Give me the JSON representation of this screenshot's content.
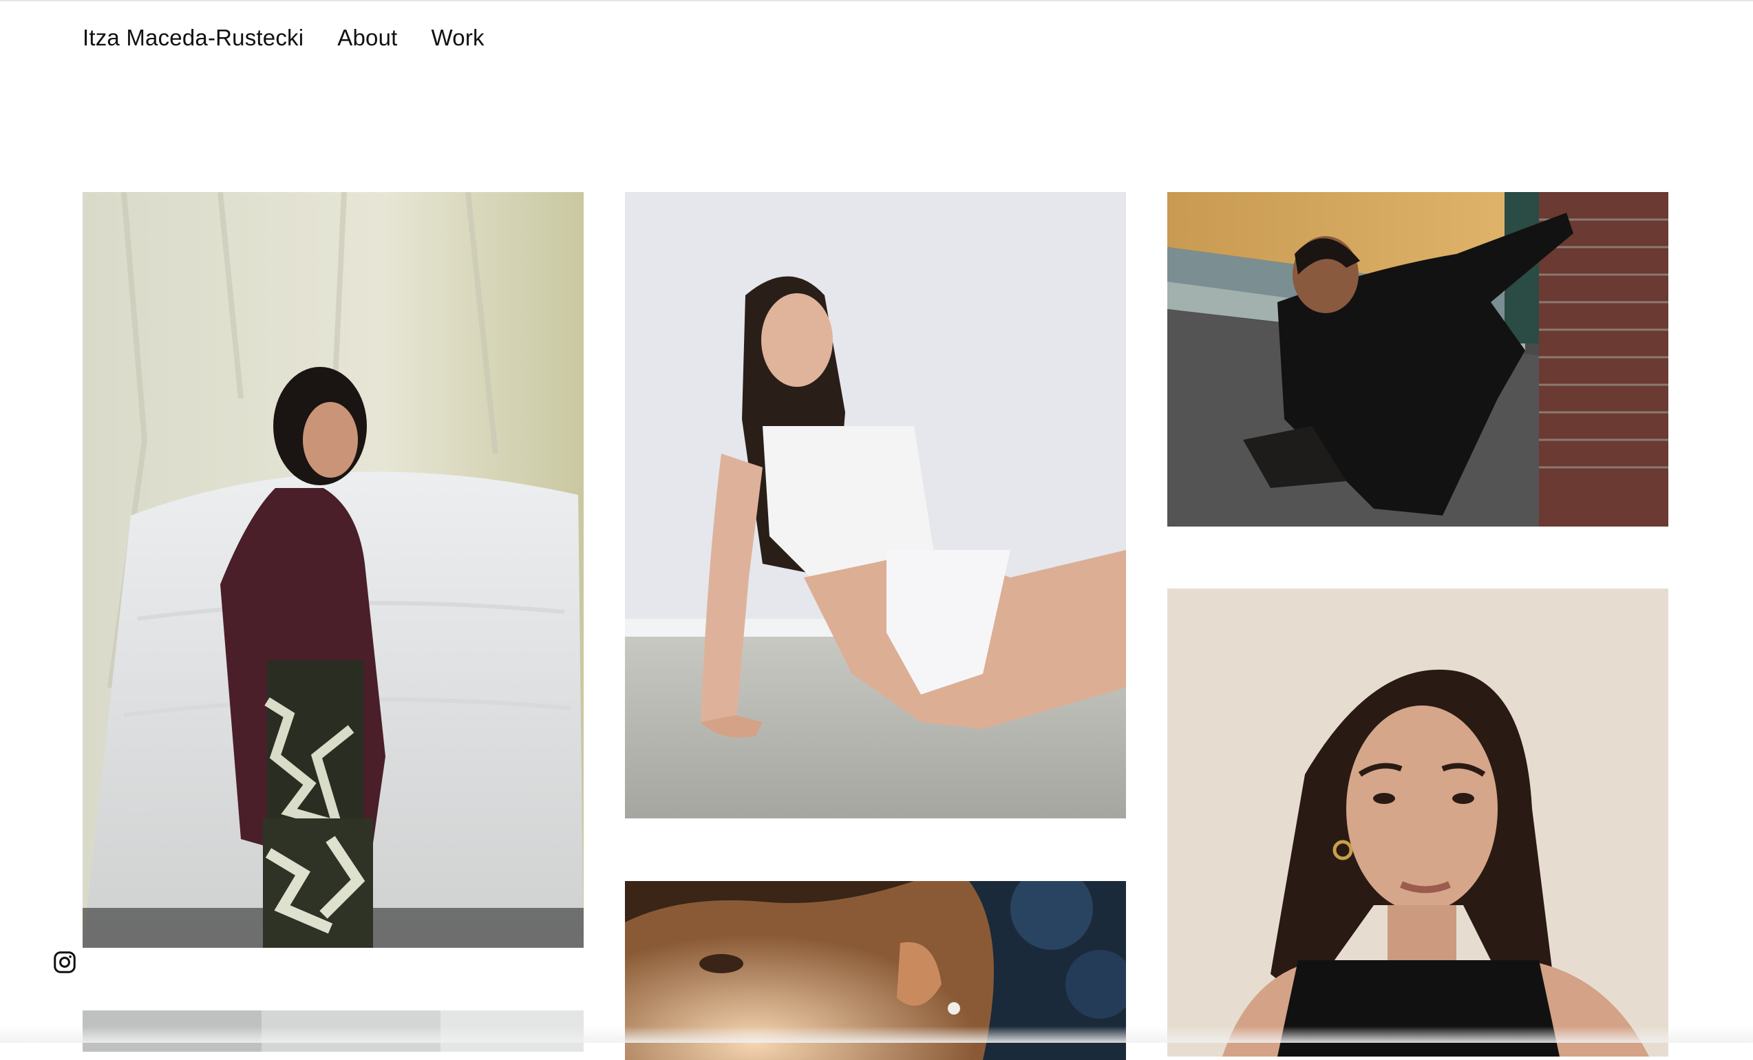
{
  "header": {
    "site_name": "Itza Maceda-Rustecki",
    "nav": [
      {
        "label": "About"
      },
      {
        "label": "Work"
      }
    ]
  },
  "gallery": {
    "images": [
      {
        "subject": "portrait in knit cardigan against draped sheet"
      },
      {
        "subject": "model seated on concrete floor in white tank top"
      },
      {
        "subject": "model leaning against brick wall at night"
      },
      {
        "subject": "cropped portrait partially visible"
      },
      {
        "subject": "close-up profile with ear cuff"
      },
      {
        "subject": "portrait with nose ring against beige wall"
      }
    ]
  },
  "social": {
    "icon": "instagram-icon"
  },
  "colors": {
    "background": "#ffffff",
    "text": "#111111"
  }
}
